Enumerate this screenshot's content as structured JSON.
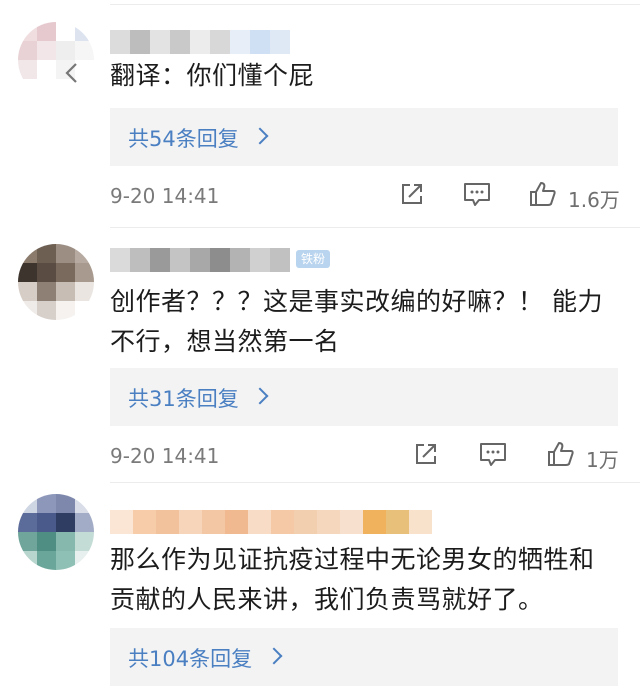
{
  "comments": [
    {
      "name": "",
      "text_lines": [
        "翻译：你们懂个屁"
      ],
      "replies_label": "共54条回复",
      "time": "9-20 14:41",
      "likes": "1.6万",
      "avatar_colors": [
        "#f0dde0",
        "#e6c9cf",
        "#ffffff",
        "#dde4f0",
        "#e8d2d6",
        "#f2e6e8",
        "#eeeeee",
        "#f6f6f6",
        "#f1e7e9",
        "#ffffff",
        "#f4f4f4",
        "#ffffff",
        "#ffffff",
        "#ffffff",
        "#ffffff",
        "#ffffff"
      ],
      "name_colors": [
        "#dcdcdc",
        "#bdbdbd",
        "#e3e3e3",
        "#c9c9c9",
        "#ececec",
        "#d8d8d8",
        "#e8eef7",
        "#cfe0f4",
        "#dfe9f6"
      ]
    },
    {
      "name": "",
      "badge": "铁粉",
      "text_lines": [
        "创作者？？？这是事实改编的好嘛？！ 能力",
        "不行，想当然第一名"
      ],
      "replies_label": "共31条回复",
      "time": "9-20 14:41",
      "likes": "1万",
      "avatar_colors": [
        "#8b7b6d",
        "#6e5f53",
        "#9c8e82",
        "#b7aba1",
        "#3d342d",
        "#5a4c42",
        "#7a6a5d",
        "#a89a8e",
        "#d6cdc6",
        "#8f8075",
        "#c8bdb5",
        "#eae5e1",
        "#efebe8",
        "#d7cfc9",
        "#f5f2ef",
        "#ffffff"
      ],
      "name_colors": [
        "#dadada",
        "#bebebe",
        "#9a9a9a",
        "#c4c4c4",
        "#a8a8a8",
        "#8d8d8d",
        "#b3b3b3",
        "#d0d0d0",
        "#c1c1c1"
      ]
    },
    {
      "name": "",
      "text_lines": [
        "那么作为见证抗疫过程中无论男女的牺牲和",
        "贡献的人民来讲，我们负责骂就好了。"
      ],
      "replies_label": "共104条回复",
      "avatar_colors": [
        "#cfd6e3",
        "#8d97b9",
        "#7e88ad",
        "#d9dde8",
        "#5b6b9a",
        "#4a5a8b",
        "#2f3d63",
        "#a3acc6",
        "#6fa59a",
        "#4f8f83",
        "#86b8ad",
        "#c4dcd6",
        "#b8d5ce",
        "#6aa79a",
        "#8fc0b5",
        "#e7f0ee"
      ],
      "name_colors": [
        "#fbe6d6",
        "#f7cda9",
        "#f2c29c",
        "#f6d5bb",
        "#f3c7a4",
        "#f0b98f",
        "#f8dcc6",
        "#f5c8a6",
        "#f2cfae",
        "#f4d7bd",
        "#f7e0cd",
        "#f0b25c",
        "#e9c079",
        "#f9e2cc"
      ]
    }
  ],
  "colors": {
    "link": "#4a7fc2",
    "meta": "#7a7a7a",
    "reply_bg": "#f3f3f3"
  },
  "icons": [
    "back-arrow-icon",
    "share-icon",
    "comment-icon",
    "like-icon",
    "chevron-right-icon"
  ]
}
